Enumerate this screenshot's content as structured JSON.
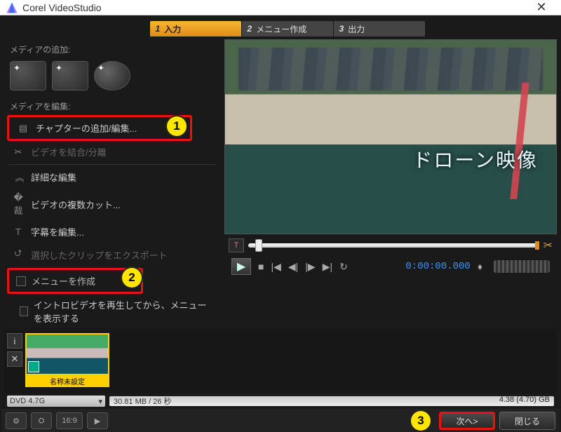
{
  "window": {
    "title": "Corel VideoStudio"
  },
  "steps": [
    {
      "num": "1",
      "label": "入力",
      "active": true
    },
    {
      "num": "2",
      "label": "メニュー作成",
      "active": false
    },
    {
      "num": "3",
      "label": "出力",
      "active": false
    }
  ],
  "left": {
    "add_media_label": "メディアの追加:",
    "edit_media_label": "メディアを編集:",
    "chapter_edit": "チャプターの追加/編集...",
    "join_split": "ビデオを結合/分離",
    "advanced_label": "詳細な編集",
    "multicut": "ビデオの複数カット...",
    "subtitles": "字幕を編集...",
    "export_clip": "選択したクリップをエクスポート",
    "create_menu": "メニューを作成",
    "intro_then_menu": "イントロビデオを再生してから、メニューを表示する"
  },
  "preview": {
    "watermark": "ドローン映像"
  },
  "playback": {
    "timecode": "0:00:00.000"
  },
  "strip": {
    "caption": "名称未設定"
  },
  "bottom": {
    "dvd": "DVD 4.7G",
    "meter_left": "30.81 MB / 26 秒",
    "meter_right": "4.38 (4.70) GB",
    "next": "次へ>",
    "close": "閉じる"
  },
  "badges": {
    "b1": "1",
    "b2": "2",
    "b3": "3"
  }
}
